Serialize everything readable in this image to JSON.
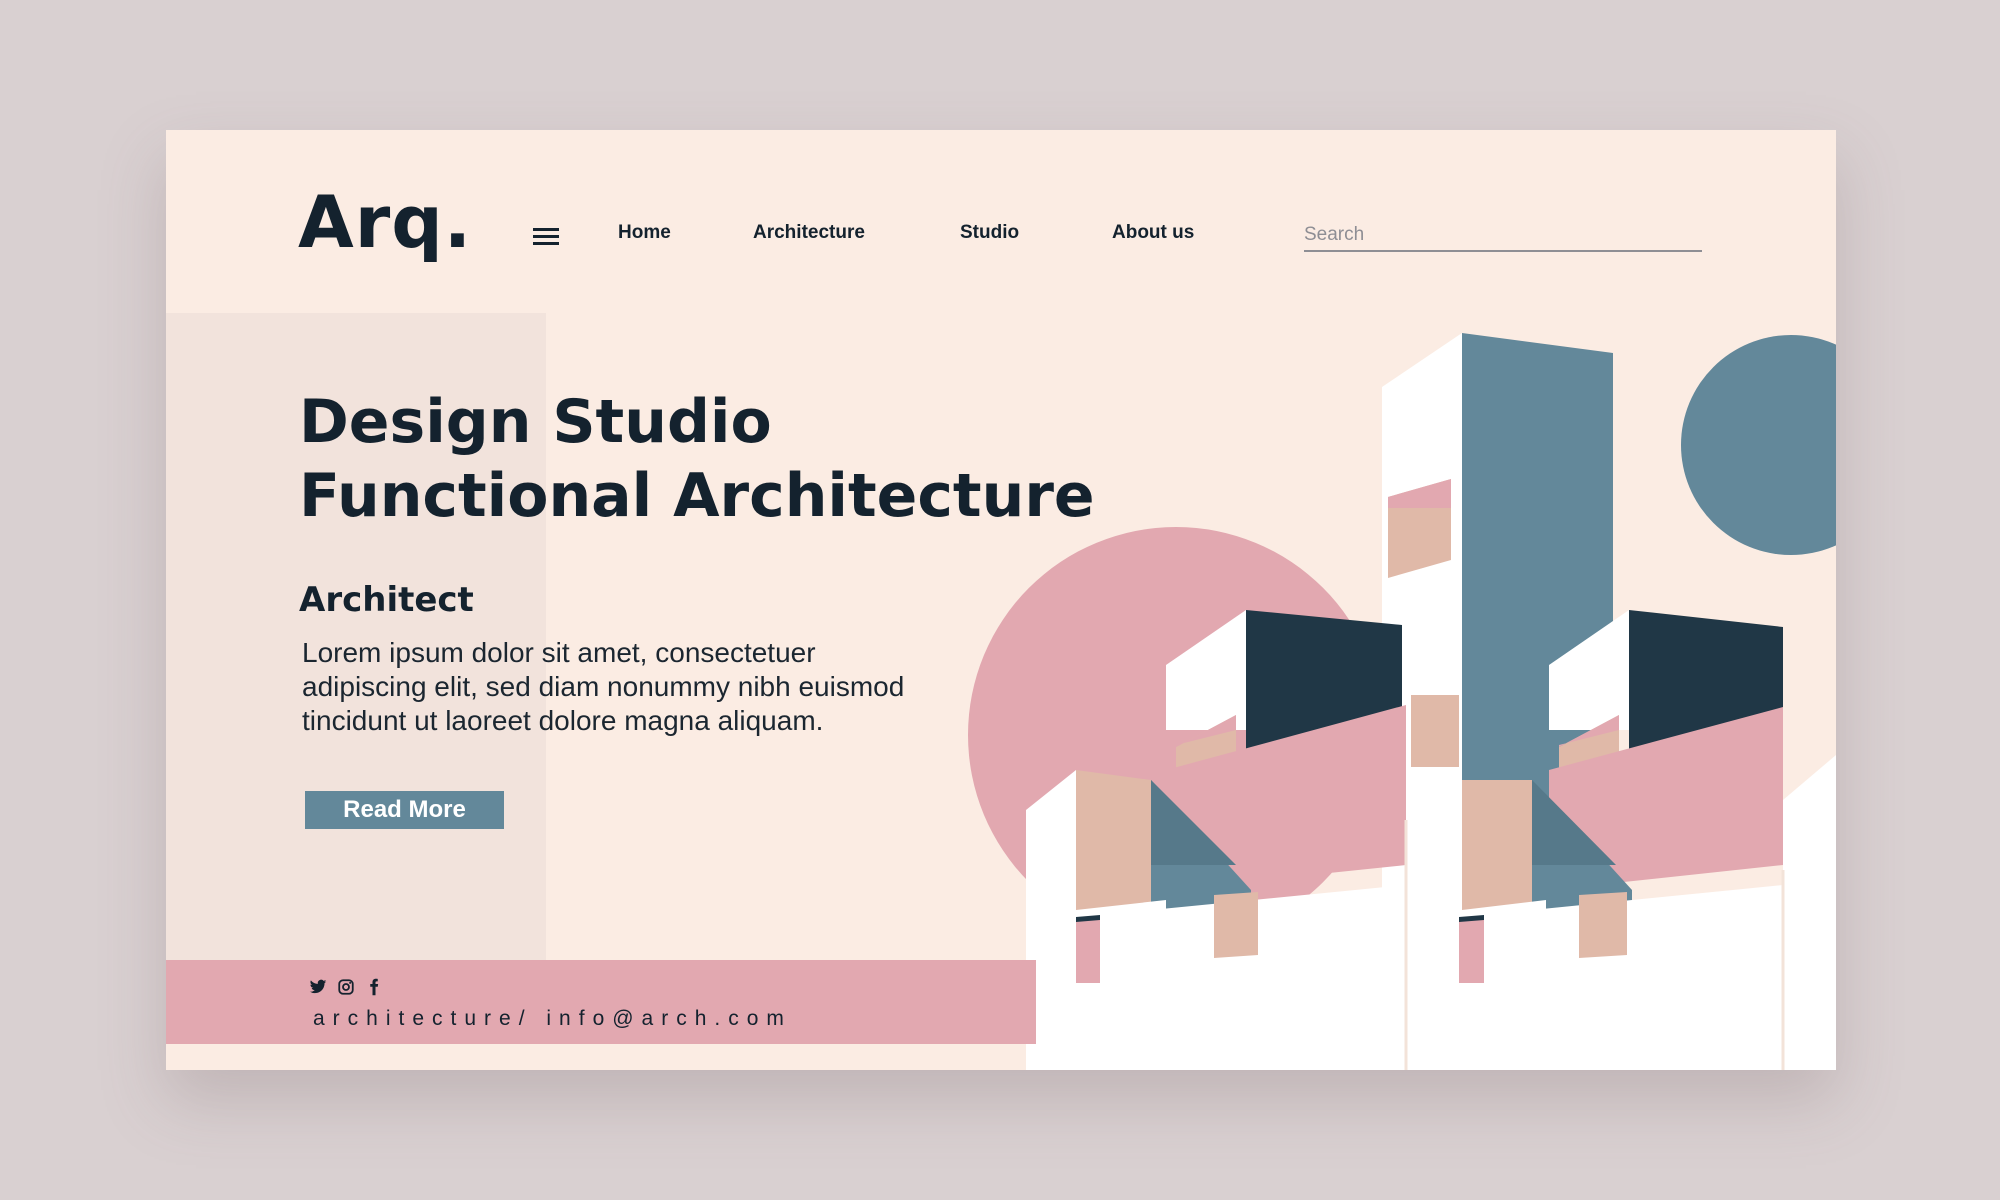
{
  "brand": {
    "logo": "Arq."
  },
  "nav": {
    "menu_icon": "hamburger-icon",
    "items": [
      {
        "label": "Home"
      },
      {
        "label": "Architecture"
      },
      {
        "label": "Studio"
      },
      {
        "label": "About us"
      }
    ],
    "search_placeholder": "Search"
  },
  "hero": {
    "title_line1": "Design Studio",
    "title_line2": "Functional Architecture",
    "subtitle": "Architect",
    "body": "Lorem ipsum dolor sit amet, consectetuer adipiscing elit, sed diam nonummy nibh euismod tincidunt ut laoreet dolore magna aliquam.",
    "cta_label": "Read More"
  },
  "footer": {
    "social_icons": [
      "twitter-icon",
      "instagram-icon",
      "facebook-icon"
    ],
    "contact": "architecture/ info@arch.com"
  },
  "colors": {
    "background": "#fbece3",
    "dark": "#14222e",
    "slate": "#63889a",
    "pink": "#e2a8b0",
    "peach": "#e0b9a8",
    "navy": "#203746"
  }
}
